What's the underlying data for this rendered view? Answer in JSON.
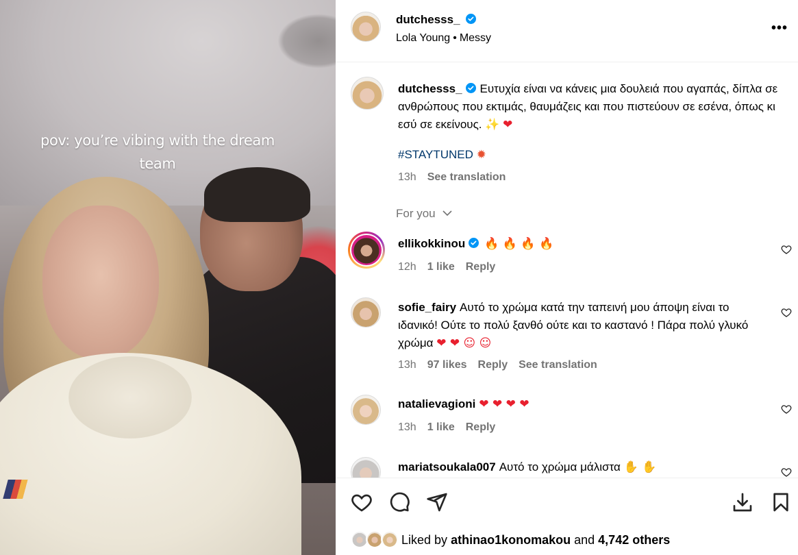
{
  "media": {
    "overlay_text": "pov: you’re vibing with the dream team"
  },
  "post_header": {
    "username": "dutchesss_",
    "music_artist": "Lola Young",
    "music_separator": "•",
    "music_title": "Messy",
    "more_label": "•••"
  },
  "caption": {
    "username": "dutchesss_",
    "text": "Ευτυχία είναι να κάνεις μια δουλειά που αγαπάς, δίπλα σε ανθρώπους που εκτιμάς, θαυμάζεις και που πιστεύουν σε εσένα, όπως κι εσύ σε εκείνους.",
    "emoji_1": "✨",
    "emoji_2": "❤",
    "hashtag": "#STAYTUNED",
    "hashtag_emoji": "✹",
    "time": "13h",
    "see_translation": "See translation"
  },
  "for_you_label": "For you",
  "comments": [
    {
      "username": "ellikokkinou",
      "text": "",
      "emojis": "🔥 🔥 🔥 🔥",
      "time": "12h",
      "likes": "1 like",
      "reply": "Reply"
    },
    {
      "username": "sofie_fairy",
      "text": "Αυτό το χρώμα κατά την ταπεινή μου άποψη είναι το ιδανικό! Ούτε το πολύ ξανθό ούτε και το καστανό ! Πάρα πολύ γλυκό χρώμα",
      "emojis": "❤ ❤ ☺ ☺",
      "time": "13h",
      "likes": "97 likes",
      "reply": "Reply",
      "see_translation": "See translation"
    },
    {
      "username": "natalievagioni",
      "text": "",
      "emojis": "❤ ❤ ❤ ❤",
      "time": "13h",
      "likes": "1 like",
      "reply": "Reply"
    },
    {
      "username": "mariatsoukala007",
      "text": "Αυτό το χρώμα μάλιστα",
      "emojis": "✋ ✋"
    }
  ],
  "likes_summary": {
    "prefix": "Liked by",
    "user": "athinao1konomakou",
    "middle": "and",
    "count": "4,742 others"
  },
  "colors": {
    "link_blue": "#00376b",
    "muted_gray": "#737373",
    "verified_blue": "#0095f6",
    "divider": "#efefef"
  },
  "icons": [
    "verified-icon",
    "more-icon",
    "chevron-down-icon",
    "heart-icon",
    "comment-icon",
    "share-icon",
    "save-icon",
    "bookmark-icon"
  ]
}
